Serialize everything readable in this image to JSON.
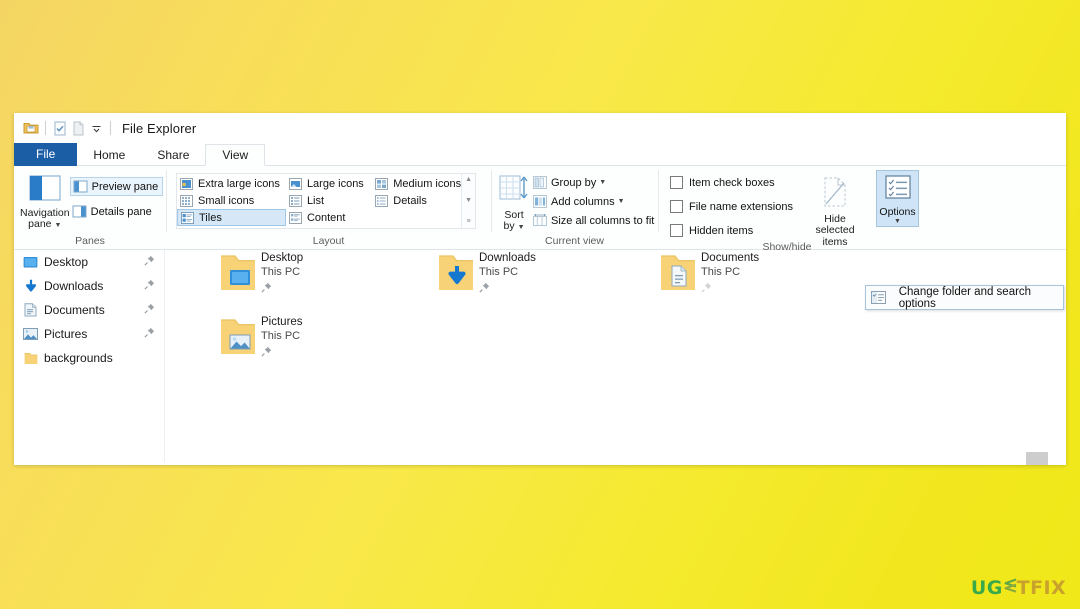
{
  "window": {
    "title": "File Explorer",
    "quick_access": [
      "folder-icon",
      "properties-icon",
      "new-folder-icon",
      "customize-caret-icon"
    ]
  },
  "tabs": [
    {
      "label": "File",
      "state": "file-menu"
    },
    {
      "label": "Home",
      "state": "inactive"
    },
    {
      "label": "Share",
      "state": "inactive"
    },
    {
      "label": "View",
      "state": "active"
    }
  ],
  "ribbon": {
    "groups": [
      {
        "name": "Panes",
        "label": "Panes",
        "big_button": {
          "label_line1": "Navigation",
          "label_line2": "pane",
          "has_caret": true
        },
        "toggles": [
          {
            "label": "Preview pane",
            "state": "outlined"
          },
          {
            "label": "Details pane",
            "state": "normal"
          }
        ]
      },
      {
        "name": "Layout",
        "label": "Layout",
        "gallery": [
          {
            "label": "Extra large icons",
            "selected": false
          },
          {
            "label": "Small icons",
            "selected": false
          },
          {
            "label": "Large icons",
            "selected": false
          },
          {
            "label": "List",
            "selected": false
          },
          {
            "label": "Content",
            "selected": false
          },
          {
            "label": "Medium icons",
            "selected": false
          },
          {
            "label": "Details",
            "selected": false
          },
          {
            "label": "Tiles",
            "selected": true
          }
        ],
        "scroll_up": "▲",
        "scroll_down": "▼",
        "scroll_more": "≡"
      },
      {
        "name": "Current view",
        "label": "Current view",
        "big_button": {
          "label_line1": "Sort",
          "label_line2": "by",
          "has_caret": true
        },
        "items": [
          {
            "label": "Group by",
            "has_caret": true
          },
          {
            "label": "Add columns",
            "has_caret": true
          },
          {
            "label": "Size all columns to fit",
            "has_caret": false
          }
        ]
      },
      {
        "name": "Show/hide",
        "label": "Show/hide",
        "checkboxes": [
          {
            "label": "Item check boxes",
            "checked": false
          },
          {
            "label": "File name extensions",
            "checked": false
          },
          {
            "label": "Hidden items",
            "checked": false
          }
        ],
        "big_button": {
          "label_line1": "Hide selected",
          "label_line2": "items",
          "has_caret": false
        }
      },
      {
        "name": "Options",
        "label": "",
        "options_button": {
          "label": "Options",
          "has_caret": true,
          "state": "pressed"
        }
      }
    ]
  },
  "options_menu": {
    "items": [
      {
        "label": "Change folder and search options",
        "icon": "folder-options-icon"
      }
    ]
  },
  "nav_pane": {
    "items": [
      {
        "label": "Desktop",
        "icon": "desktop-icon",
        "pinned": true
      },
      {
        "label": "Downloads",
        "icon": "downloads-icon",
        "pinned": true
      },
      {
        "label": "Documents",
        "icon": "documents-icon",
        "pinned": true
      },
      {
        "label": "Pictures",
        "icon": "pictures-icon",
        "pinned": true
      },
      {
        "label": "backgrounds",
        "icon": "folder-icon",
        "pinned": false
      }
    ]
  },
  "file_area": {
    "tiles": [
      {
        "name": "Desktop",
        "sub": "This PC",
        "overlay": "desktop-icon",
        "pinned": true
      },
      {
        "name": "Downloads",
        "sub": "This PC",
        "overlay": "downloads-icon",
        "pinned": true
      },
      {
        "name": "Documents",
        "sub": "This PC",
        "overlay": "documents-icon",
        "pinned": true
      },
      {
        "name": "Pictures",
        "sub": "This PC",
        "overlay": "pictures-icon",
        "pinned": true
      }
    ]
  },
  "watermark": {
    "part1": "UG",
    "part2": "TFIX"
  },
  "colors": {
    "accent_blue": "#1b5ea6",
    "selection_blue": "#d6e8f7",
    "folder_yellow": "#f6d27a",
    "background_yellow_start": "#f4d564",
    "background_yellow_end": "#f0e818",
    "watermark_green": "#3aa94a",
    "watermark_gold": "#c8a22c"
  }
}
